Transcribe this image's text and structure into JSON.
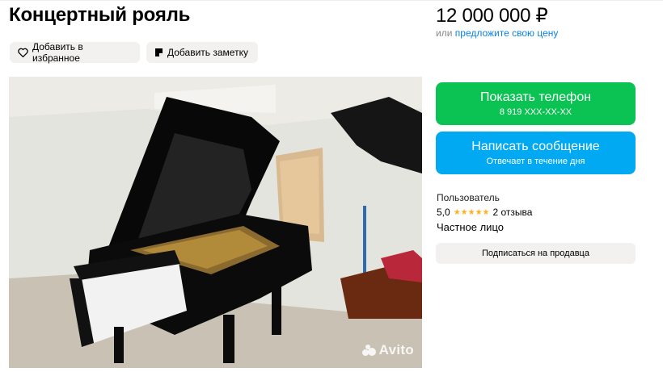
{
  "listing": {
    "title": "Концертный рояль",
    "price": "12 000 000 ₽",
    "price_or": "или",
    "price_offer_link": "предложите свою цену"
  },
  "actions": {
    "favorite_label": "Добавить в избранное",
    "note_label": "Добавить заметку"
  },
  "contact": {
    "phone_label": "Показать телефон",
    "phone_number": "8 919 XXX-XX-XX",
    "message_label": "Написать сообщение",
    "message_sub": "Отвечает в течение дня"
  },
  "seller": {
    "role": "Пользователь",
    "rating": "5,0",
    "stars": "★★★★★",
    "reviews": "2 отзыва",
    "type": "Частное лицо",
    "subscribe_label": "Подписаться на продавца"
  },
  "photo": {
    "watermark": "Avito"
  },
  "colors": {
    "phone_button": "#0ac352",
    "message_button": "#00a9f2",
    "link": "#0a82e6",
    "star": "#ffb021"
  },
  "icons": [
    "heart-icon",
    "note-icon",
    "avito-logo-icon"
  ]
}
